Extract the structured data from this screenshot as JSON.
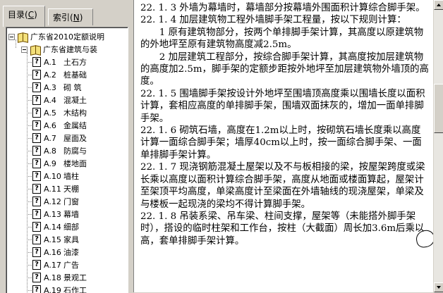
{
  "tabs": {
    "contents": "目录",
    "contents_key": "C",
    "index": "索引",
    "index_key": "N"
  },
  "tree": {
    "root": "广东省2010定额说明",
    "child": "广东省建筑与装",
    "items": [
      {
        "code": "A.1",
        "label": "土石方"
      },
      {
        "code": "A.2",
        "label": "桩基础"
      },
      {
        "code": "A.3",
        "label": "砌 筑"
      },
      {
        "code": "A.4",
        "label": "混凝土"
      },
      {
        "code": "A.5",
        "label": "木结构"
      },
      {
        "code": "A.6",
        "label": "金属结"
      },
      {
        "code": "A.7",
        "label": "屋面及"
      },
      {
        "code": "A.8",
        "label": "防腐与"
      },
      {
        "code": "A.9",
        "label": "楼地面"
      },
      {
        "code": "A.10",
        "label": "墙柱"
      },
      {
        "code": "A.11",
        "label": "天棚"
      },
      {
        "code": "A.12",
        "label": "门窗"
      },
      {
        "code": "A.13",
        "label": "幕墙"
      },
      {
        "code": "A.14",
        "label": "细部"
      },
      {
        "code": "A.15",
        "label": "家具"
      },
      {
        "code": "A.16",
        "label": "油漆"
      },
      {
        "code": "A.17",
        "label": "广告"
      },
      {
        "code": "A.18",
        "label": "景观工"
      },
      {
        "code": "A.19",
        "label": "石作工"
      }
    ]
  },
  "content": {
    "paragraphs": [
      {
        "text": "22. 1. 3  外墙为幕墙时，幕墙部分按幕墙外围面积计算综合脚手架。",
        "indent": false
      },
      {
        "text": "22. 1. 4  加层建筑物工程外墙脚手架工程量，按以下规则计算：",
        "indent": false
      },
      {
        "text": "1  原有建筑物部分，按两个单排脚手架计算，其高度以原建筑物的外地坪至原有建筑物高度减2.5m。",
        "indent": true
      },
      {
        "text": "2  加层建筑工程部分，按综合脚手架计算，其高度按加层建筑物的高度加2.5m，脚手架的定额步距按外地坪至加层建筑物外墙顶的高度。",
        "indent": true
      },
      {
        "text": "22. 1. 5  围墙脚手架按设计外地坪至围墙顶高度乘以围墙长度以面积计算，套相应高度的单排脚手架，围墙双面抹灰的，增加一面单排脚手架。",
        "indent": false
      },
      {
        "text": "22. 1. 6  砌筑石墙，高度在1.2m以上时，按砌筑石墙长度乘以高度计算一面综合脚手架；墙厚40cm以上时，按一面综合脚手架、一面单排脚手架计算。",
        "indent": false
      },
      {
        "text": "22. 1. 7  现浇钢筋混凝土屋架以及不与板相接的梁，按屋架跨度或梁长乘以高度以面积计算综合脚手架，高度从地面或楼面算起，屋架计至架顶平均高度，单梁高度计至梁面在外墙轴线的现浇屋架，单梁及与楼板一起现浇的梁均不得计算脚手架。",
        "indent": false
      },
      {
        "text": "22. 1. 8  吊装系梁、吊车梁、柱间支撑，屋架等（未能搭外脚手架时），搭设的临时柱架和工作台，按柱（大截面）周长加3.6m后乘以高，套单排脚手架计算。",
        "indent": false
      }
    ]
  },
  "scrollbar": {
    "thumb_position": 0.33,
    "thumb_size": 0.18
  }
}
